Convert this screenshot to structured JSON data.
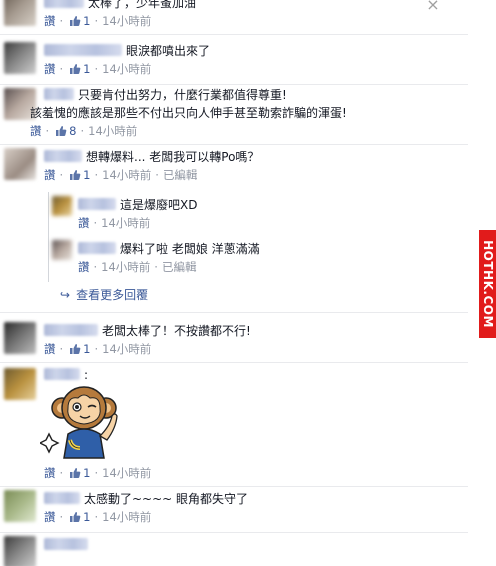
{
  "ui": {
    "like_label": "讚",
    "edited_label": "已編輯",
    "separator": "·",
    "close_glyph": "×",
    "view_more_arrow": "↪"
  },
  "comments": [
    {
      "text": "太棒了，少年蚤加油",
      "likes": "1",
      "time": "14小時前"
    },
    {
      "text": "眼淚都噴出來了",
      "likes": "1",
      "time": "14小時前"
    },
    {
      "text_line1": "只要肯付出努力，什麼行業都值得尊重!",
      "text_line2": "該羞愧的應該是那些不付出只向人伸手甚至勒索詐騙的渾蛋!",
      "likes": "8",
      "time": "14小時前"
    },
    {
      "text": "想轉爆料... 老闆我可以轉Po嗎？",
      "likes": "1",
      "time": "14小時前",
      "edited": true
    },
    {
      "text": "老闆太棒了！不按讚都不行!",
      "likes": "1",
      "time": "14小時前"
    },
    {
      "text": ":",
      "likes": "1",
      "time": "14小時前"
    },
    {
      "text": "太感動了~~~~ 眼角都失守了",
      "likes": "1",
      "time": "14小時前"
    }
  ],
  "replies": [
    {
      "text": "這是爆廢吧XD",
      "time": "14小時前"
    },
    {
      "text": "爆料了啦 老闆娘 洋蔥滿滿",
      "time": "14小時前",
      "edited": true
    }
  ],
  "view_more_replies": "查看更多回覆",
  "watermark": "HOTHK.COM",
  "colors": {
    "link": "#3b5998",
    "meta": "#9197a3",
    "watermark_bg": "#e11b1b"
  },
  "icons": [
    "thumbs-up-icon",
    "close-icon",
    "reply-arrow-icon",
    "monkey-sticker"
  ]
}
